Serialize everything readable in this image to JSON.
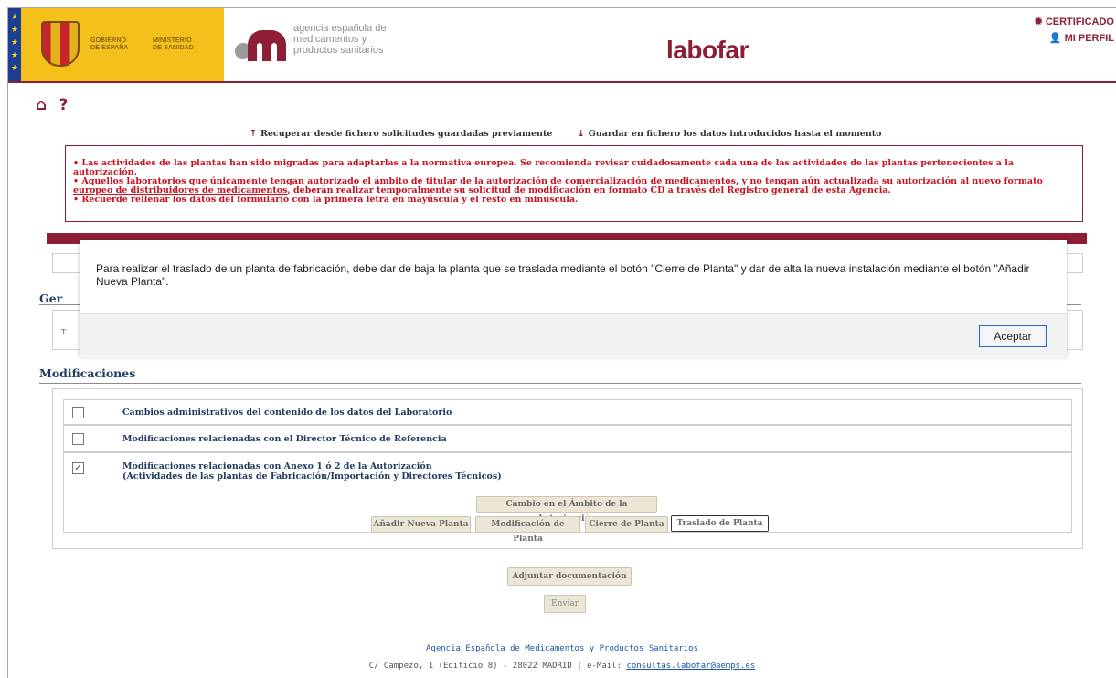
{
  "header": {
    "gov_text_1": "GOBIERNO\nDE ESPAÑA",
    "gov_text_2": "MINISTERIO\nDE SANIDAD",
    "agency_text": "agencia española de\nmedicamentos y\nproductos sanitarios",
    "brand": "labofar",
    "certificado_label": "CERTIFICADO",
    "perfil_label": "MI PERFIL",
    "accent_color": "#8e1d36"
  },
  "nav": {
    "home_icon": "home-icon",
    "help_label": "?"
  },
  "file_actions": {
    "recover_label": "Recuperar desde fichero solicitudes guardadas previamente",
    "save_label": "Guardar en fichero los datos introducidos hasta el momento"
  },
  "notice": {
    "line1": "• Las actividades de las plantas han sido migradas para adaptarlas a la normativa europea. Se recomienda revisar cuidadosamente cada una de las actividades de las plantas pertenecientes a la autorización.",
    "line2_a": "• Aquellos laboratorios que únicamente tengan autorizado el ámbito de titular de la autorización de comercialización de medicamentos, ",
    "line2_u": "y no tengan aún actualizada su autorización al nuevo formato europeo de distribuidores de medicamentos",
    "line2_b": ", deberán realizar temporalmente su solicitud de modificación en formato CD a través del Registro general de esta Agencia.",
    "line3": "• Recuerde rellenar los datos del formulario con la primera letra en mayúscula y el resto en minúscula."
  },
  "sections": {
    "general_partial": "Ger",
    "general_row_partial": "T",
    "modificaciones_title": "Modificaciones"
  },
  "modificaciones": {
    "items": [
      {
        "label": "Cambios administrativos del contenido de los datos del Laboratorio",
        "checked": false
      },
      {
        "label": "Modificaciones relacionadas con el Director Técnico de Referencia",
        "checked": false
      },
      {
        "label": "Modificaciones relacionadas con Anexo 1 ó 2 de la Autorización",
        "label2": "(Actividades de las plantas de Fabricación/Importación y Directores Técnicos)",
        "checked": true
      }
    ],
    "ambito_button": "Cambio en el Ámbito de la Autorización",
    "add_plant_button": "Añadir Nueva Planta",
    "modify_plant_button": "Modificación de Planta",
    "close_plant_button": "Cierre de Planta",
    "move_plant_button": "Traslado de Planta"
  },
  "actions": {
    "attach_button": "Adjuntar documentación",
    "send_button": "Enviar"
  },
  "footer": {
    "agency_link": "Agencia Española de Medicamentos y Productos Sanitarios",
    "address": "C/ Campezo, 1 (Edificio 8) - 28022 MADRID | e-Mail: ",
    "email": "consultas.labofar@aemps.es"
  },
  "dialog": {
    "message": "Para realizar el traslado de un planta de fabricación, debe dar de baja la planta que se traslada mediante el botón \"Cierre de Planta\" y dar de alta la nueva instalación mediante el botón \"Añadir Nueva Planta\".",
    "ok_label": "Aceptar"
  }
}
